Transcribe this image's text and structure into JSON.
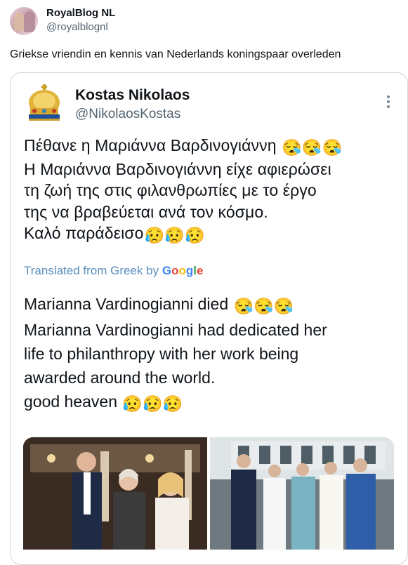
{
  "tweet": {
    "author_name": "RoyalBlog NL",
    "author_handle": "@royalblognl",
    "text": "Griekse vriendin en kennis van Nederlands koningspaar overleden"
  },
  "quoted": {
    "author_name": "Kostas Nikolaos",
    "author_handle": "@NikolaosKostas",
    "greek_lines": [
      "Πέθανε η Μαριάννα Βαρδινογιάννη",
      "Η Μαριάννα Βαρδινογιάννη είχε αφιερώσει",
      "τη ζωή της στις φιλανθρωπίες με το έργο",
      "της να βραβεύεται ανά τον κόσμο.",
      "Καλό παράδεισο"
    ],
    "translated_prefix": "Translated from Greek by",
    "translated_brand": "Google",
    "english_lines": [
      "Marianna Vardinogianni died",
      "Marianna Vardinogianni had dedicated her",
      "life to philanthropy with her work being",
      "awarded around the world.",
      "good heaven"
    ],
    "emoji_sets": {
      "crying_sleepy": "😪😪😪",
      "sad": "😥😥😥"
    }
  }
}
